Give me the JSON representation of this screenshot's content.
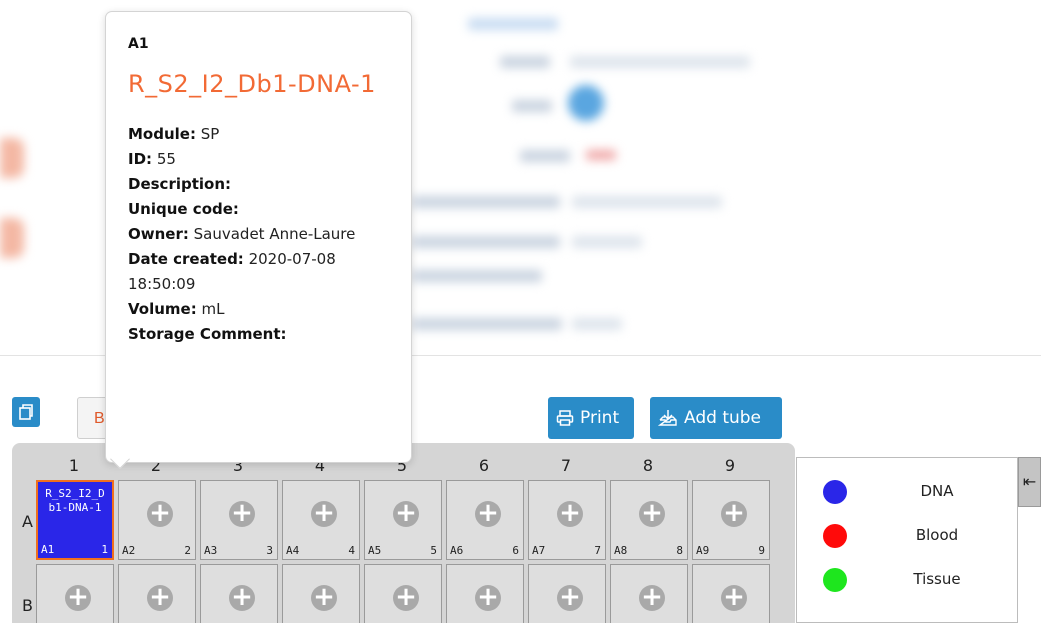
{
  "tooltip": {
    "position": "A1",
    "sample_name": "R_S2_I2_Db1-DNA-1",
    "fields": [
      {
        "label": "Module:",
        "value": "SP"
      },
      {
        "label": "ID:",
        "value": "55"
      },
      {
        "label": "Description:",
        "value": ""
      },
      {
        "label": "Unique code:",
        "value": ""
      },
      {
        "label": "Owner:",
        "value": "Sauvadet Anne-Laure"
      },
      {
        "label": "Date created:",
        "value": "2020-07-08 18:50:09"
      },
      {
        "label": "Volume:",
        "value": "mL"
      },
      {
        "label": "Storage Comment:",
        "value": ""
      }
    ]
  },
  "toolbar": {
    "partial_button_label": "Bo",
    "print_label": "Print",
    "add_tube_label": "Add tube"
  },
  "plate": {
    "columns": [
      "1",
      "2",
      "3",
      "4",
      "5",
      "6",
      "7",
      "8",
      "9"
    ],
    "rows": [
      "A",
      "B"
    ],
    "row_a": [
      {
        "pos": "A1",
        "num": "1",
        "name": "R_S2_I2_Db1-DNA-1",
        "filled": true
      },
      {
        "pos": "A2",
        "num": "2",
        "filled": false
      },
      {
        "pos": "A3",
        "num": "3",
        "filled": false
      },
      {
        "pos": "A4",
        "num": "4",
        "filled": false
      },
      {
        "pos": "A5",
        "num": "5",
        "filled": false
      },
      {
        "pos": "A6",
        "num": "6",
        "filled": false
      },
      {
        "pos": "A7",
        "num": "7",
        "filled": false
      },
      {
        "pos": "A8",
        "num": "8",
        "filled": false
      },
      {
        "pos": "A9",
        "num": "9",
        "filled": false
      }
    ],
    "plus_glyph": "+"
  },
  "legend": [
    {
      "label": "DNA",
      "color": "#2a26e8"
    },
    {
      "label": "Blood",
      "color": "#ff0a0a"
    },
    {
      "label": "Tissue",
      "color": "#1ee61e"
    }
  ],
  "colors": {
    "accent": "#2a8cc8",
    "sample_name": "#f26a35",
    "selected_border": "#f0701e"
  }
}
